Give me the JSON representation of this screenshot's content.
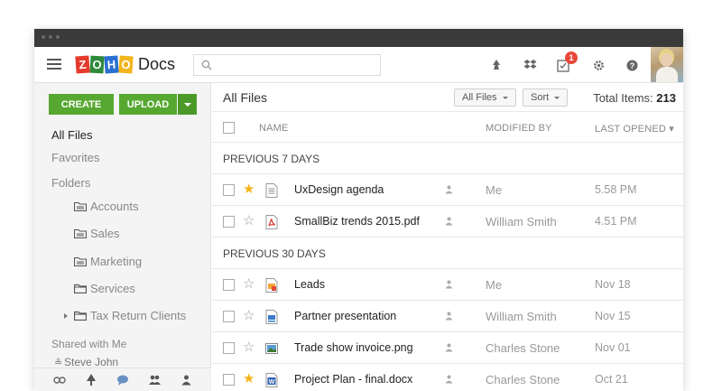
{
  "app": {
    "logo_letters": [
      "Z",
      "O",
      "H",
      "O"
    ],
    "logo_product": "Docs",
    "search_placeholder": "",
    "notification_count": "1",
    "icons": [
      "hamburger-icon",
      "search-icon",
      "recycle-icon",
      "dropbox-icon",
      "tasks-icon",
      "gear-icon",
      "help-icon"
    ]
  },
  "sidebar": {
    "create_label": "CREATE",
    "upload_label": "UPLOAD",
    "items": [
      {
        "label": "All Files"
      },
      {
        "label": "Favorites"
      },
      {
        "label": "Folders"
      },
      {
        "label": "Accounts"
      },
      {
        "label": "Sales"
      },
      {
        "label": "Marketing"
      },
      {
        "label": "Services"
      },
      {
        "label": "Tax Return Clients"
      },
      {
        "label": "Shared with Me"
      },
      {
        "label": "Steve John"
      }
    ],
    "bottom_icons": [
      "link-icon",
      "tree-icon",
      "chat-icon",
      "group-icon",
      "user-icon"
    ]
  },
  "main": {
    "title": "All Files",
    "filter_label": "All Files",
    "sort_label": "Sort",
    "total_label": "Total Items:",
    "total_count": "213",
    "columns": {
      "name": "NAME",
      "modified_by": "MODIFIED BY",
      "last_opened": "LAST OPENED"
    },
    "sections": [
      {
        "label": "PREVIOUS 7 DAYS"
      },
      {
        "label": "PREVIOUS 30 DAYS"
      }
    ],
    "rows": [
      {
        "name": "UxDesign agenda",
        "modified_by": "Me",
        "last_opened": "5.58 PM",
        "starred": true,
        "icon": "document-icon"
      },
      {
        "name": "SmallBiz trends 2015.pdf",
        "modified_by": "William Smith",
        "last_opened": "4.51 PM",
        "starred": false,
        "icon": "pdf-icon"
      },
      {
        "name": "Leads",
        "modified_by": "Me",
        "last_opened": "Nov 18",
        "starred": false,
        "icon": "spreadsheet-icon"
      },
      {
        "name": "Partner presentation",
        "modified_by": "William Smith",
        "last_opened": "Nov 15",
        "starred": false,
        "icon": "presentation-icon"
      },
      {
        "name": "Trade show invoice.png",
        "modified_by": "Charles Stone",
        "last_opened": "Nov 01",
        "starred": false,
        "icon": "image-icon"
      },
      {
        "name": "Project Plan - final.docx",
        "modified_by": "Charles Stone",
        "last_opened": "Oct 21",
        "starred": true,
        "icon": "word-icon"
      }
    ]
  },
  "colors": {
    "create_green": "#56a831",
    "star_gold": "#f5b41a",
    "badge_red": "#e8483b",
    "titlebar": "#3a3a3a"
  }
}
